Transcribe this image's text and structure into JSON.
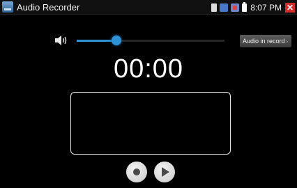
{
  "window": {
    "title": "Audio Recorder",
    "icon": "recorder-app-icon"
  },
  "status_bar": {
    "time": "8:07 PM",
    "icons": [
      "sd-card-icon",
      "notification-icon",
      "warning-icon",
      "battery-icon"
    ],
    "close_label": "✕"
  },
  "volume": {
    "icon": "speaker-icon",
    "level": 0.27
  },
  "audio_in_record": {
    "label": "Audio in record",
    "chevron": "›"
  },
  "timer": "00:00",
  "controls": {
    "record_icon": "record-icon",
    "play_icon": "play-icon"
  },
  "colors": {
    "accent": "#2e93d6",
    "close": "#d42a2a",
    "background": "#000000"
  }
}
